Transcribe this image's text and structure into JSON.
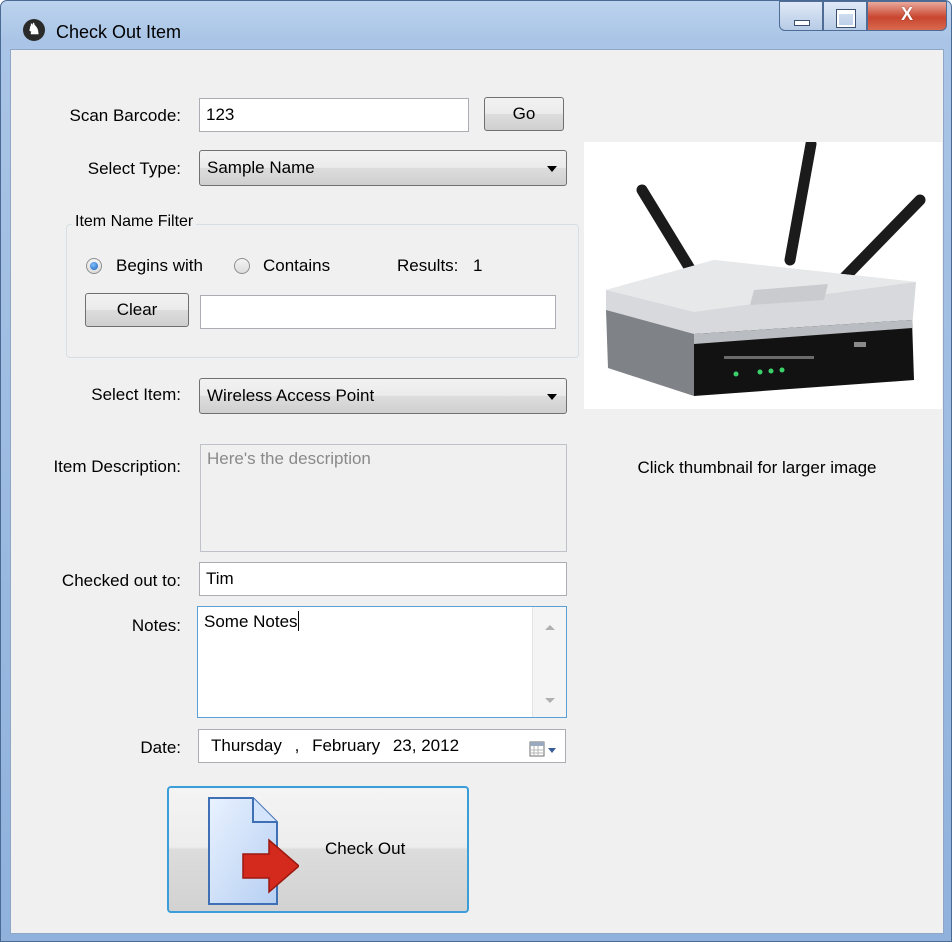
{
  "window": {
    "title": "Check Out Item",
    "app_icon_glyph": "♞",
    "controls": {
      "minimize": "minimize-icon",
      "maximize": "maximize-icon",
      "close_glyph": "X"
    }
  },
  "form": {
    "scan_barcode": {
      "label": "Scan Barcode:",
      "value": "123",
      "go_label": "Go"
    },
    "select_type": {
      "label": "Select Type:",
      "value": "Sample Name"
    },
    "item_name_filter": {
      "title": "Item Name Filter",
      "begins_with_label": "Begins with",
      "begins_with_checked": true,
      "contains_label": "Contains",
      "contains_checked": false,
      "results_label": "Results:",
      "results_count": "1",
      "clear_label": "Clear",
      "filter_value": ""
    },
    "select_item": {
      "label": "Select Item:",
      "value": "Wireless Access Point"
    },
    "item_description": {
      "label": "Item Description:",
      "value": "Here's the description"
    },
    "checked_out_to": {
      "label": "Checked out to:",
      "value": "Tim"
    },
    "notes": {
      "label": "Notes:",
      "value": "Some Notes"
    },
    "date": {
      "label": "Date:",
      "weekday": "Thursday",
      "separator": ",",
      "month": "February",
      "day_year": "23, 2012",
      "calendar_icon": "calendar-icon"
    },
    "check_out_button": {
      "label": "Check Out",
      "icon": "document-arrow-icon"
    }
  },
  "thumbnail": {
    "image": "wireless-router-image",
    "caption": "Click thumbnail for larger image"
  },
  "colors": {
    "accent_border": "#3c9ed9",
    "close_red": "#c9452f",
    "arrow_red": "#d42a1e"
  }
}
